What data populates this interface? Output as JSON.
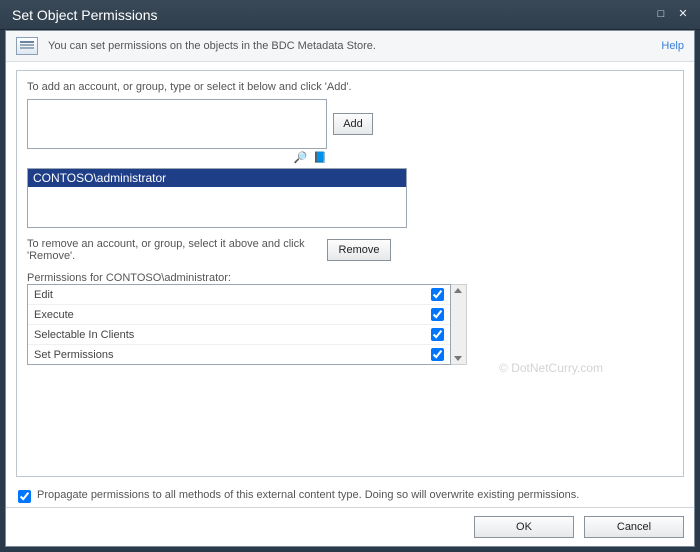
{
  "title": "Set Object Permissions",
  "info_text": "You can set permissions on the objects in the BDC Metadata Store.",
  "help_label": "Help",
  "add_hint": "To add an account, or group, type or select it below and click 'Add'.",
  "add_button": "Add",
  "account_input_value": "",
  "icon_names": {
    "check_name": "check-name-icon",
    "browse": "browse-directory-icon"
  },
  "accounts": [
    "CONTOSO\\administrator"
  ],
  "remove_hint": "To remove an account, or group, select it above and click 'Remove'.",
  "remove_button": "Remove",
  "perm_header": "Permissions for CONTOSO\\administrator:",
  "permissions": [
    {
      "label": "Edit",
      "checked": true
    },
    {
      "label": "Execute",
      "checked": true
    },
    {
      "label": "Selectable In Clients",
      "checked": true
    },
    {
      "label": "Set Permissions",
      "checked": true
    }
  ],
  "propagate_checked": true,
  "propagate_label": "Propagate permissions to all methods of this external content type. Doing so will overwrite existing permissions.",
  "ok_label": "OK",
  "cancel_label": "Cancel",
  "watermark": "© DotNetCurry.com"
}
